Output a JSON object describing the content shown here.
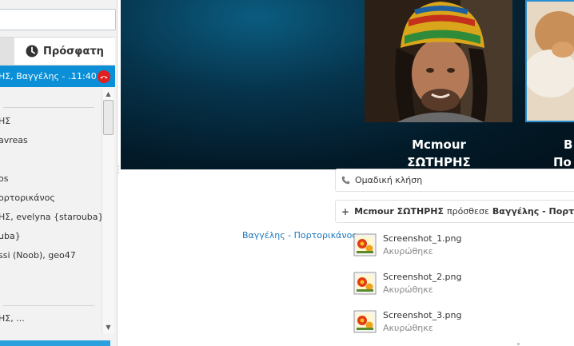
{
  "sidebar": {
    "tab_recent_label": "Πρόσφατη",
    "active_call": {
      "names": "ΗΣ, Βαγγέλης - ...",
      "time": "11:40"
    },
    "contacts": [
      "ΗΣ",
      "avreas",
      "os",
      "ορτορικάνος",
      "ΗΣ, evelyna {starouba}",
      "uba}",
      "ssi (Noob), geo47",
      "ΗΣ, ..."
    ]
  },
  "video": {
    "participants": [
      {
        "name_line1": "Mcmour",
        "name_line2": "ΣΩΤΗΡΗΣ"
      },
      {
        "name_line1": "B",
        "name_line2": "Πο"
      }
    ],
    "dots": "..."
  },
  "chat": {
    "group_call_label": "Ομαδική κλήση",
    "added_message": {
      "actor": "Mcmour ΣΩΤΗΡΗΣ",
      "verb": "πρόσθεσε",
      "target": "Βαγγέλης - Πορτορικά"
    },
    "sender": "Βαγγέλης - Πορτορικάνος",
    "files": [
      {
        "name": "Screenshot_1.png",
        "status": "Ακυρώθηκε"
      },
      {
        "name": "Screenshot_2.png",
        "status": "Ακυρώθηκε"
      },
      {
        "name": "Screenshot_3.png",
        "status": "Ακυρώθηκε"
      }
    ]
  },
  "colors": {
    "accent": "#0b8fd7",
    "hangup": "#e02020",
    "link": "#1a78c2"
  },
  "icons": [
    "clock-icon",
    "hangup-phone-icon",
    "phone-icon",
    "plus-icon",
    "image-file-icon"
  ]
}
